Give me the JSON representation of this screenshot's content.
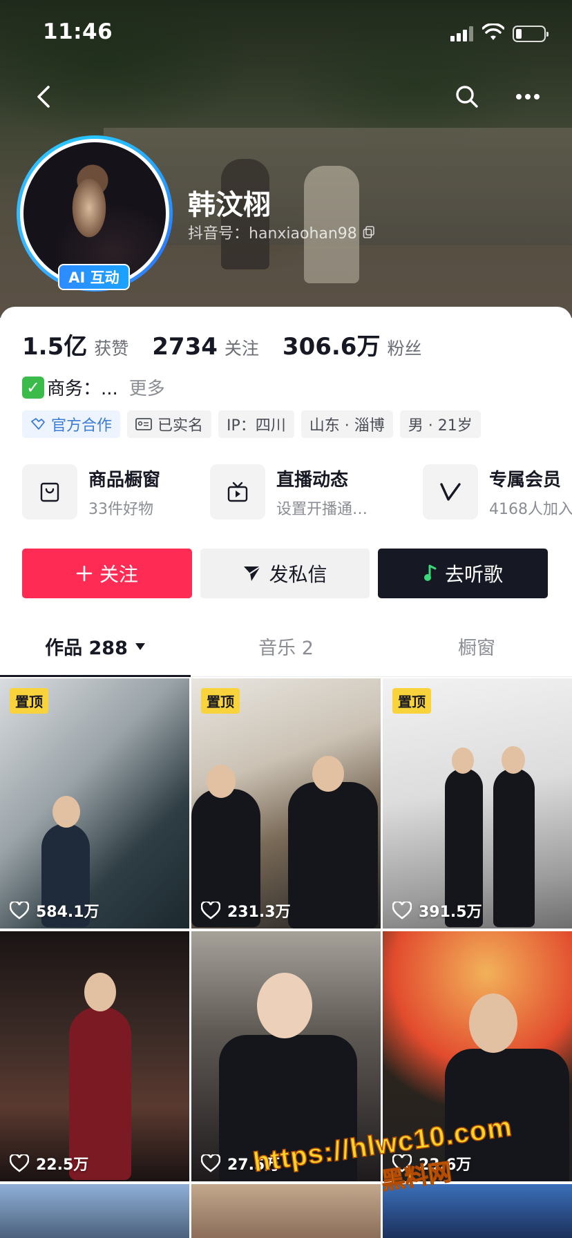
{
  "status_bar": {
    "time": "11:46"
  },
  "profile": {
    "name": "韩汶栩",
    "id_label": "抖音号：hanxiaohan98",
    "ai_badge": "AI 互动"
  },
  "stats": [
    {
      "num": "1.5亿",
      "label": "获赞"
    },
    {
      "num": "2734",
      "label": "关注"
    },
    {
      "num": "306.6万",
      "label": "粉丝"
    }
  ],
  "bio": {
    "text": "商务：...",
    "more": "更多"
  },
  "tags": [
    "官方合作",
    "已实名",
    "IP：四川",
    "山东 · 淄博",
    "男 · 21岁"
  ],
  "services": [
    {
      "title": "商品橱窗",
      "sub": "33件好物",
      "icon": "bag-icon"
    },
    {
      "title": "直播动态",
      "sub": "设置开播通…",
      "icon": "live-tv-icon"
    },
    {
      "title": "专属会员",
      "sub": "4168人加入",
      "icon": "v-member-icon"
    }
  ],
  "actions": {
    "follow": "关注",
    "message": "发私信",
    "music": "去听歌"
  },
  "tabs": [
    {
      "label": "作品 288"
    },
    {
      "label": "音乐 2"
    },
    {
      "label": "橱窗"
    }
  ],
  "videos": [
    {
      "pinned": "置顶",
      "likes": "584.1万"
    },
    {
      "pinned": "置顶",
      "likes": "231.3万"
    },
    {
      "pinned": "置顶",
      "likes": "391.5万"
    },
    {
      "pinned": "",
      "likes": "22.5万"
    },
    {
      "pinned": "",
      "likes": "27.5万"
    },
    {
      "pinned": "",
      "likes": "23.6万"
    }
  ],
  "watermark": {
    "url": "https://hlwc10.com",
    "name": "黑料网"
  },
  "colors": {
    "accent": "#fe2c55",
    "dark_button": "#161823",
    "pin_badge": "#f9d33c",
    "ai_badge": "#2e8bff"
  }
}
